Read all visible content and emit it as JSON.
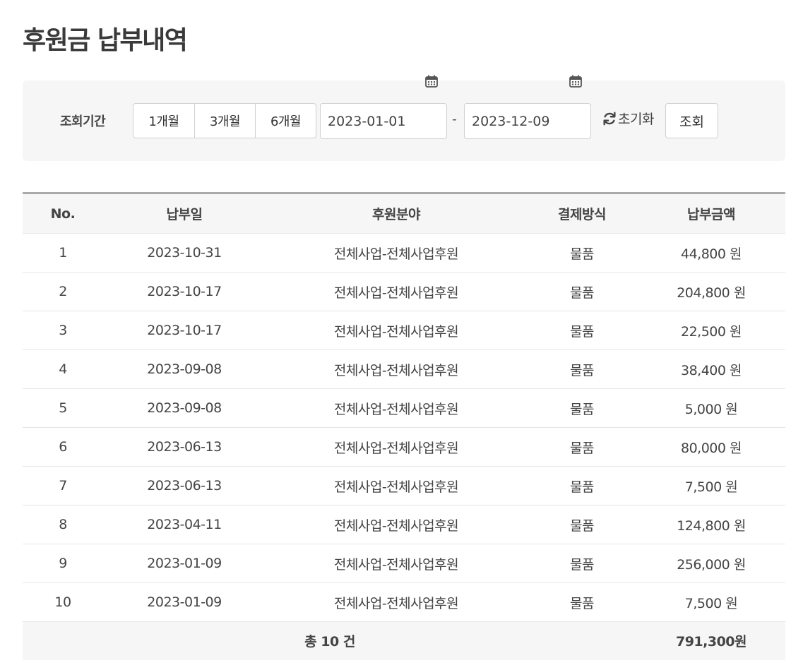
{
  "page_title": "후원금 납부내역",
  "search": {
    "label": "조회기간",
    "periods": [
      "1개월",
      "3개월",
      "6개월"
    ],
    "date_from": "2023-01-01",
    "date_to": "2023-12-09",
    "range_separator": "-",
    "reset_label": "초기화",
    "submit_label": "조회"
  },
  "table": {
    "headers": [
      "No.",
      "납부일",
      "후원분야",
      "결제방식",
      "납부금액"
    ],
    "rows": [
      {
        "no": "1",
        "date": "2023-10-31",
        "field": "전체사업-전체사업후원",
        "method": "물품",
        "amount": "44,800 원"
      },
      {
        "no": "2",
        "date": "2023-10-17",
        "field": "전체사업-전체사업후원",
        "method": "물품",
        "amount": "204,800 원"
      },
      {
        "no": "3",
        "date": "2023-10-17",
        "field": "전체사업-전체사업후원",
        "method": "물품",
        "amount": "22,500 원"
      },
      {
        "no": "4",
        "date": "2023-09-08",
        "field": "전체사업-전체사업후원",
        "method": "물품",
        "amount": "38,400 원"
      },
      {
        "no": "5",
        "date": "2023-09-08",
        "field": "전체사업-전체사업후원",
        "method": "물품",
        "amount": "5,000 원"
      },
      {
        "no": "6",
        "date": "2023-06-13",
        "field": "전체사업-전체사업후원",
        "method": "물품",
        "amount": "80,000 원"
      },
      {
        "no": "7",
        "date": "2023-06-13",
        "field": "전체사업-전체사업후원",
        "method": "물품",
        "amount": "7,500 원"
      },
      {
        "no": "8",
        "date": "2023-04-11",
        "field": "전체사업-전체사업후원",
        "method": "물품",
        "amount": "124,800 원"
      },
      {
        "no": "9",
        "date": "2023-01-09",
        "field": "전체사업-전체사업후원",
        "method": "물품",
        "amount": "256,000 원"
      },
      {
        "no": "10",
        "date": "2023-01-09",
        "field": "전체사업-전체사업후원",
        "method": "물품",
        "amount": "7,500 원"
      }
    ],
    "footer": {
      "count_label": "총 10 건",
      "total_label": "791,300원"
    }
  },
  "icons": {
    "calendar": "calendar-icon",
    "reset": "refresh-icon"
  }
}
